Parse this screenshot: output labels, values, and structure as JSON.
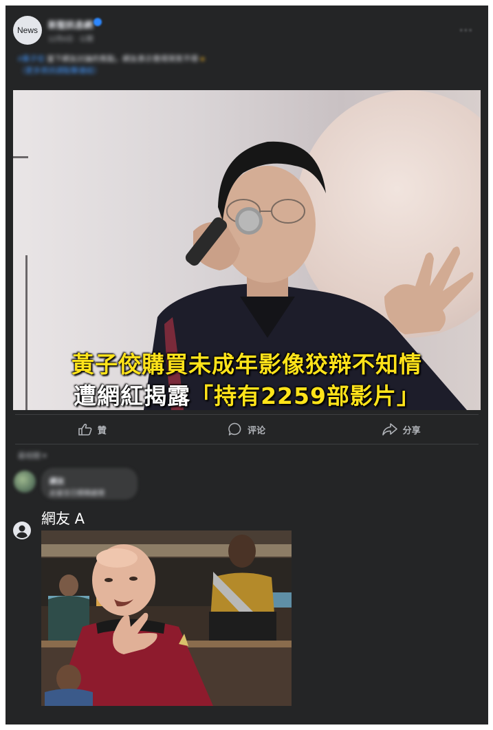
{
  "post": {
    "avatar_text": "News",
    "page_name": "新聖訊息網",
    "meta": "12月6日 · 公開",
    "more_glyph": "···",
    "text_tag": "#黃子佼",
    "text_body": " 當下網友討論的焦點，網友表示覺得哭笑不得 ",
    "text_emoji": "●",
    "text_line2": "（更多資訊請點擊連結）"
  },
  "photo": {
    "headline_line1": "黃子佼購買未成年影像狡辩不知情",
    "headline_line2_white": "遭網紅揭露",
    "headline_line2_yellow": "「持有2259部影片」"
  },
  "actions": {
    "like_label": "贊",
    "comment_label": "评论",
    "share_label": "分享"
  },
  "comments": {
    "sort_label": "最相關 ▾",
    "first": {
      "name": "網友",
      "text": "此留言已模糊處理"
    },
    "second": {
      "name": "網友 A"
    }
  },
  "colors": {
    "card_bg": "#242526",
    "headline_yellow": "#ffe31a",
    "text_primary": "#e4e6eb",
    "text_secondary": "#b0b3b8",
    "link_blue": "#4599ff"
  },
  "icons": {
    "like": "thumbs-up-icon",
    "comment": "comment-bubble-icon",
    "share": "share-arrow-icon",
    "more": "more-options-icon",
    "verified": "verified-badge-icon",
    "user": "user-silhouette-icon"
  }
}
